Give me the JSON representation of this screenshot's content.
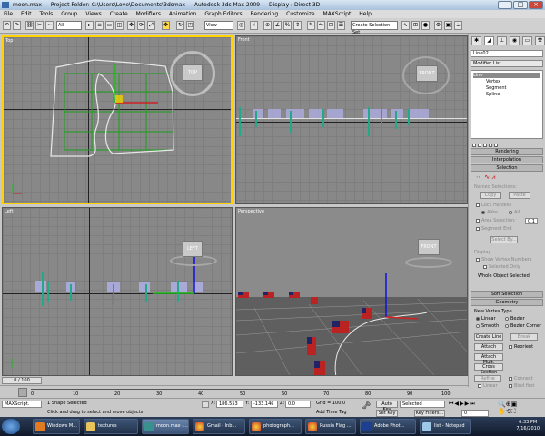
{
  "window": {
    "title_file": "moon.max",
    "title_project": "Project Folder: C:\\Users\\Love\\Documents\\3dsmax",
    "title_app": "Autodesk 3ds Max 2009",
    "title_display": "Display : Direct 3D"
  },
  "menu": [
    "File",
    "Edit",
    "Tools",
    "Group",
    "Views",
    "Create",
    "Modifiers",
    "Animation",
    "Graph Editors",
    "Rendering",
    "Customize",
    "MAXScript",
    "Help"
  ],
  "toolbar": {
    "filter_select": "All",
    "refcoord_select": "View",
    "named_selection_placeholder": "Create Selection Set"
  },
  "viewports": {
    "top": {
      "label": "Top",
      "cube": "TOP"
    },
    "front": {
      "label": "Front",
      "cube": "FRONT"
    },
    "left": {
      "label": "Left",
      "cube": "LEFT"
    },
    "perspective": {
      "label": "Perspective",
      "cube": "FRONT"
    }
  },
  "command_panel": {
    "object_name": "Line02",
    "modifier_list": "Modifier List",
    "stack": [
      "Line",
      "Vertex",
      "Segment",
      "Spline"
    ],
    "rollouts": {
      "rendering": "Rendering",
      "interpolation": "Interpolation",
      "selection": "Selection",
      "soft_selection": "Soft Selection",
      "geometry": "Geometry"
    },
    "selection": {
      "named_selections": "Named Selections:",
      "copy": "Copy",
      "paste": "Paste",
      "lock_handles": "Lock Handles",
      "alike": "Alike",
      "all": "All",
      "area_selection": "Area Selection:",
      "area_value": "0.1",
      "segment_end": "Segment End",
      "select_by": "Select By...",
      "display": "Display",
      "show_vertex_numbers": "Show Vertex Numbers",
      "selected_only": "Selected Only",
      "whole_object_selected": "Whole Object Selected"
    },
    "geometry": {
      "new_vertex_type": "New Vertex Type",
      "linear": "Linear",
      "bezier": "Bezier",
      "smooth": "Smooth",
      "bezier_corner": "Bezier Corner",
      "create_line": "Create Line",
      "break": "Break",
      "attach": "Attach",
      "reorient": "Reorient",
      "attach_mult": "Attach Mult.",
      "cross_section": "Cross Section",
      "refine": "Refine",
      "connect": "Connect",
      "linear_chk": "Linear",
      "bind_first": "Bind first"
    }
  },
  "timeline": {
    "frame": "0 / 100",
    "ticks": [
      "0",
      "10",
      "20",
      "30",
      "40",
      "50",
      "60",
      "70",
      "80",
      "90",
      "100"
    ]
  },
  "status": {
    "maxscript": "MAXScript.",
    "selection": "1 Shape Selected",
    "prompt": "Click and drag to select and move objects",
    "x_label": "X:",
    "x_value": "186.553",
    "y_label": "Y:",
    "y_value": "-133.146",
    "z_label": "Z:",
    "z_value": "0.0",
    "grid": "Grid = 100.0",
    "add_time_tag": "Add Time Tag",
    "auto_key": "Auto Key",
    "set_key": "Set Key",
    "key_mode": "Selected",
    "key_filters": "Key Filters...",
    "frame_field": "0"
  },
  "taskbar": {
    "items": [
      "Windows M...",
      "textures",
      "moon.max -...",
      "Gmail - Inb...",
      "photograph...",
      "Russia Flag ...",
      "Adobe Phot...",
      "list - Notepad"
    ],
    "time": "6:33 PM",
    "date": "7/16/2010"
  },
  "colors": {
    "active_viewport": "#ffd200",
    "taskbar": "#1a2740"
  }
}
